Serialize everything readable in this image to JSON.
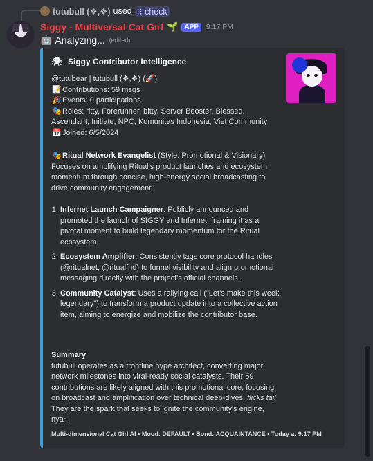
{
  "reply": {
    "username": "tutubull (❖,❖)",
    "used_text": "used",
    "command": "check"
  },
  "message": {
    "bot_name": "Siggy - Multiversal Cat Girl",
    "badge": "APP",
    "timestamp": "9:17 PM",
    "content": "Analyzing...",
    "edited": "(edited)"
  },
  "embed": {
    "accent_color": "#3ba2d9",
    "author": "Siggy Contributor Intelligence",
    "user_line": "@tutubear | tutubull (❖,❖) (🚀)",
    "contributions": "Contributions: 59 msgs",
    "events": "Events: 0 participations",
    "roles": "Roles: ritty, Forerunner, bitty, Server Booster, Blessed, Ascendant, Initiate, NPC, Komunitas Indonesia, Viet Community",
    "joined": "Joined: 6/5/2024",
    "archetype_title": "Ritual Network Evangelist",
    "archetype_style": "(Style: Promotional & Visionary)",
    "archetype_desc": "Focuses on amplifying Ritual's product launches and ecosystem momentum through concise, high-energy social broadcasting to drive community engagement.",
    "factors": [
      {
        "title": "Infernet Launch Campaigner",
        "text": ": Publicly announced and promoted the launch of SIGGY and Infernet, framing it as a pivotal moment to build legendary momentum for the Ritual ecosystem."
      },
      {
        "title": "Ecosystem Amplifier",
        "text": ": Consistently tags core protocol handles (@ritualnet, @ritualfnd) to funnel visibility and align promotional messaging directly with the project's official channels."
      },
      {
        "title": "Community Catalyst",
        "text": ": Uses a rallying call (\"Let's make this week legendary\") to transform a product update into a collective action item, aiming to energize and mobilize the contributor base."
      }
    ],
    "summary_title": "Summary",
    "summary_text": "tutubull operates as a frontline hype architect, converting major network milestones into viral-ready social catalysts. Their 59 contributions are likely aligned with this promotional core, focusing on broadcast and amplification over technical deep-dives. ",
    "summary_italic": "flicks tail",
    "summary_end": " They are the spark that seeks to ignite the community's engine, nya~.",
    "footer": "Multi-dimensional Cat Girl AI • Mood: DEFAULT • Bond: ACQUAINTANCE • Today at 9:17 PM"
  }
}
